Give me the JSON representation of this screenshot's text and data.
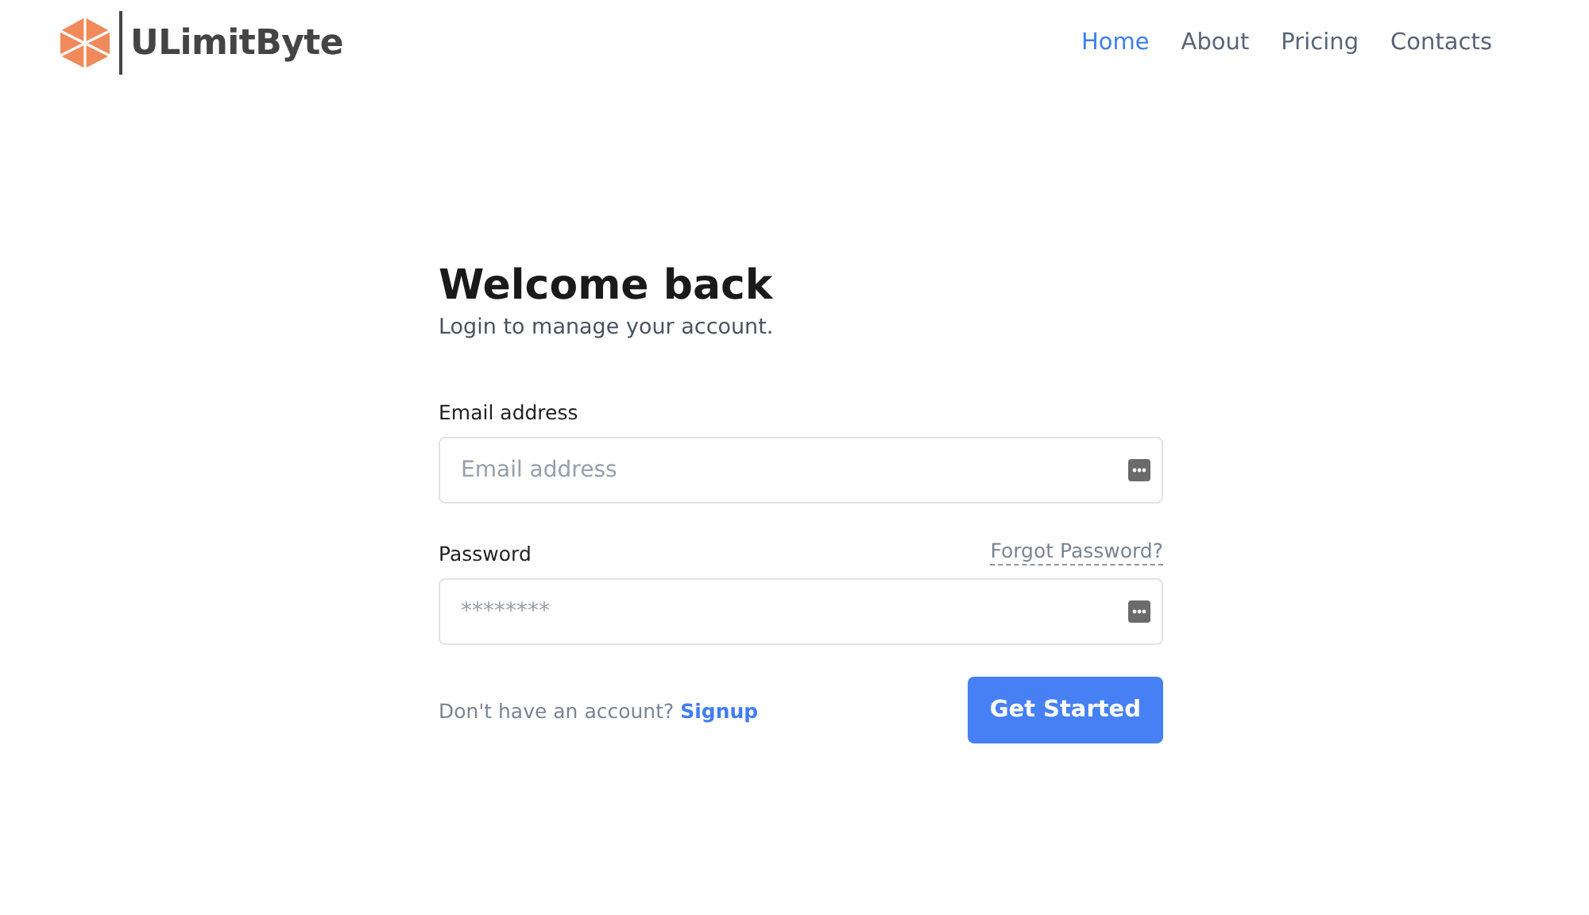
{
  "header": {
    "logo": "ULimitByte",
    "nav": [
      {
        "label": "Home",
        "selected": true
      },
      {
        "label": "About",
        "selected": false
      },
      {
        "label": "Pricing",
        "selected": false
      },
      {
        "label": "Contacts",
        "selected": false
      }
    ]
  },
  "login": {
    "title": "Welcome back",
    "subtitle": "Login to manage your account.",
    "fields": [
      {
        "label": "Email address",
        "placeholder": "Email address"
      },
      {
        "label": "Password",
        "placeholder": "********",
        "link": "Forgot Password?"
      }
    ],
    "signup_prompt": "Don't have an account?",
    "signup_link": "Signup",
    "submit": "Get Started"
  }
}
